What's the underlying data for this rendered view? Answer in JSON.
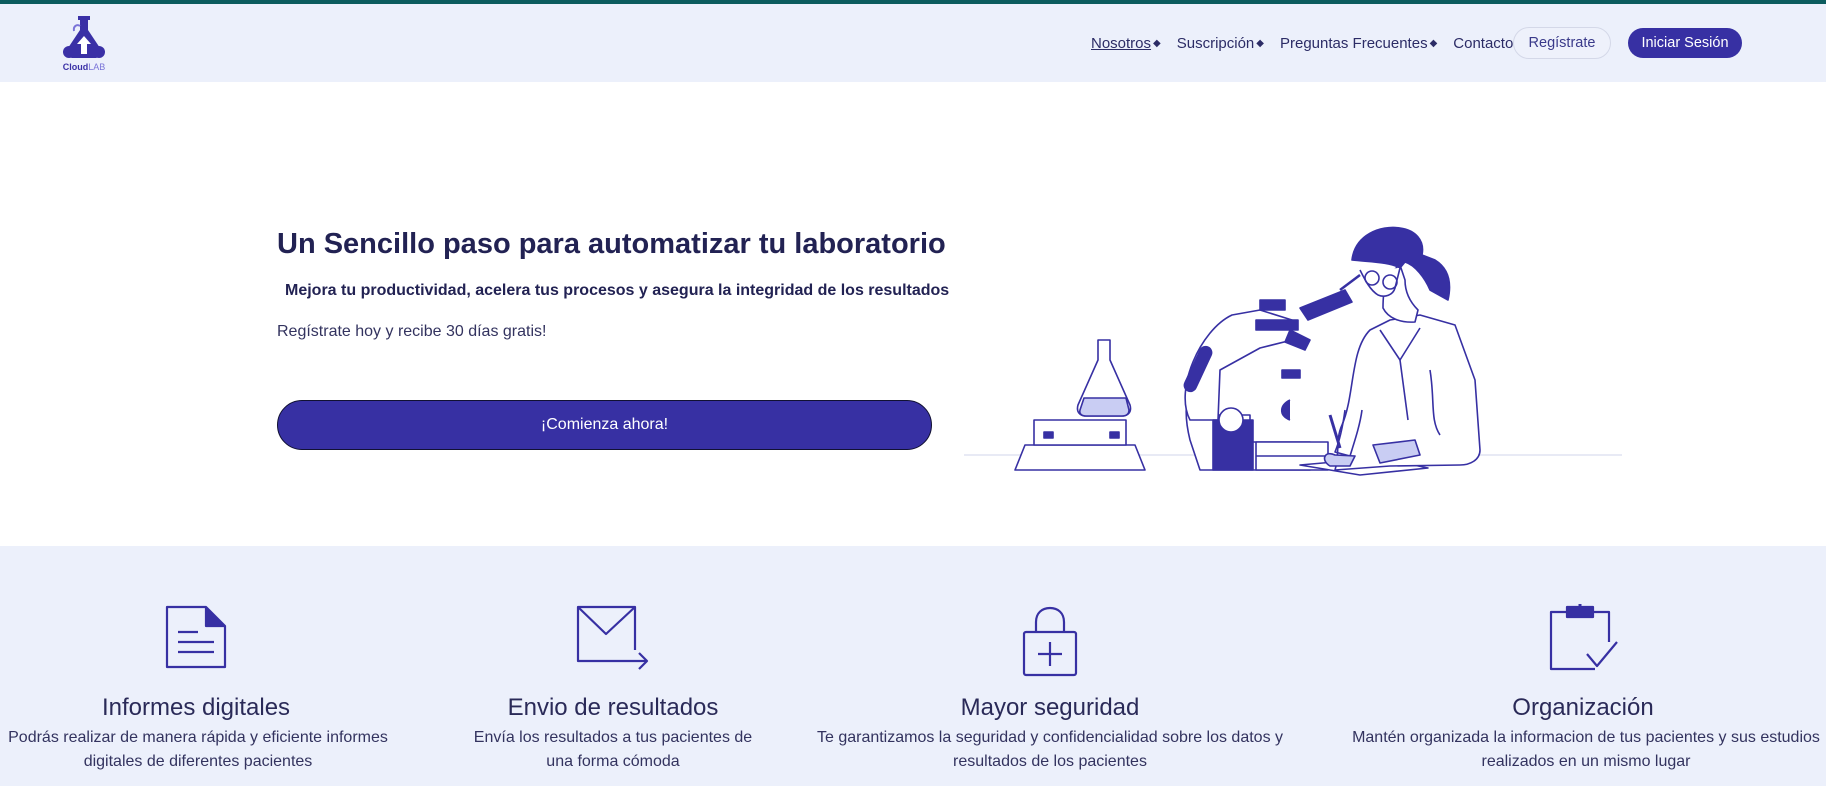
{
  "logo": {
    "name_bold": "Cloud",
    "name_light": "LAB"
  },
  "nav": {
    "items": [
      {
        "label": "Nosotros",
        "has_caret": true,
        "active": true
      },
      {
        "label": "Suscripción",
        "has_caret": true,
        "active": false
      },
      {
        "label": "Preguntas Frecuentes",
        "has_caret": true,
        "active": false
      },
      {
        "label": "Contacto",
        "has_caret": false,
        "active": false
      }
    ],
    "register_label": "Regístrate",
    "login_label": "Iniciar Sesión"
  },
  "hero": {
    "title": "Un Sencillo paso para automatizar tu laboratorio",
    "subtitle": "Mejora tu productividad, acelera tus procesos y asegura la integridad de los resultados",
    "promo": "Regístrate hoy y recibe 30 días gratis!",
    "cta_label": "¡Comienza ahora!"
  },
  "features": [
    {
      "icon": "document-icon",
      "title": "Informes digitales",
      "description": "Podrás realizar de manera rápida y eficiente informes digitales de diferentes pacientes"
    },
    {
      "icon": "mail-send-icon",
      "title": "Envio de resultados",
      "description": "Envía los resultados a tus pacientes de una forma cómoda"
    },
    {
      "icon": "lock-icon",
      "title": "Mayor seguridad",
      "description": "Te garantizamos la seguridad y confidencialidad sobre los datos y resultados de los pacientes"
    },
    {
      "icon": "clipboard-check-icon",
      "title": "Organización",
      "description": "Mantén organizada la informacion de tus pacientes y sus estudios realizados en un mismo lugar"
    }
  ],
  "colors": {
    "primary": "#3730a3",
    "header_bg": "#ecf0fb",
    "top_line": "#0c5c5e",
    "text_dark": "#222253"
  }
}
